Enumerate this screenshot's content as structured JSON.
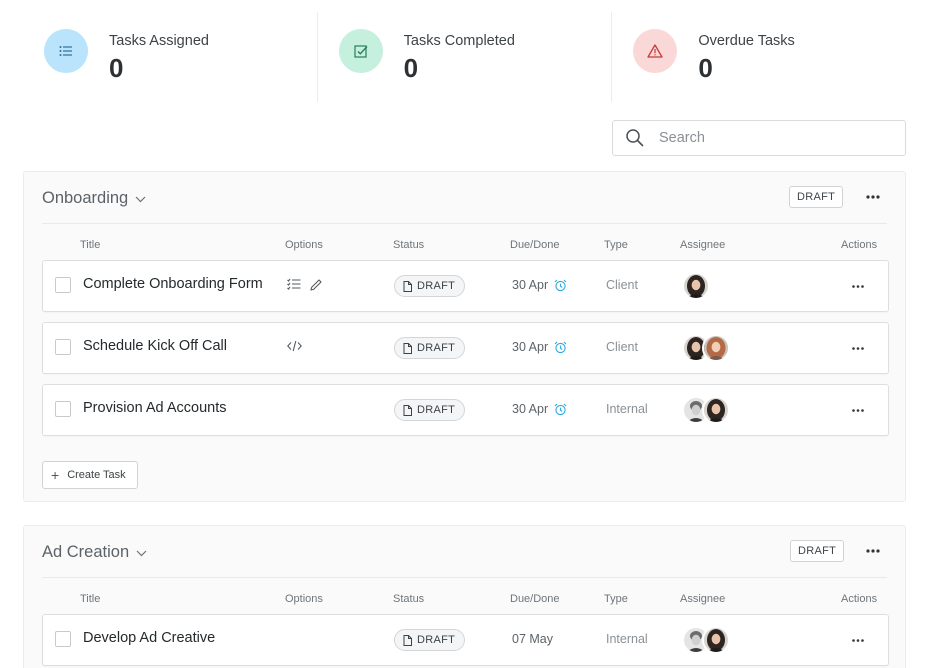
{
  "stats": [
    {
      "label": "Tasks Assigned",
      "value": "0",
      "icon": "list-icon",
      "color": "#b9e4fb"
    },
    {
      "label": "Tasks Completed",
      "value": "0",
      "icon": "check-square-icon",
      "color": "#c5f0de"
    },
    {
      "label": "Overdue Tasks",
      "value": "0",
      "icon": "warning-icon",
      "color": "#fbd8d8"
    }
  ],
  "search": {
    "placeholder": "Search"
  },
  "columns": {
    "title": "Title",
    "options": "Options",
    "status": "Status",
    "due": "Due/Done",
    "type": "Type",
    "assignee": "Assignee",
    "actions": "Actions"
  },
  "sections": [
    {
      "name": "Onboarding",
      "status": "DRAFT",
      "create_label": "Create Task",
      "tasks": [
        {
          "title": "Complete Onboarding Form",
          "status": "DRAFT",
          "due": "30 Apr",
          "type": "Client",
          "options": [
            "checklist-icon",
            "pencil-icon"
          ]
        },
        {
          "title": "Schedule Kick Off Call",
          "status": "DRAFT",
          "due": "30 Apr",
          "type": "Client",
          "options": [
            "code-icon"
          ]
        },
        {
          "title": "Provision Ad Accounts",
          "status": "DRAFT",
          "due": "30 Apr",
          "type": "Internal",
          "options": []
        }
      ]
    },
    {
      "name": "Ad Creation",
      "status": "DRAFT",
      "tasks": [
        {
          "title": "Develop Ad Creative",
          "status": "DRAFT",
          "due": "07 May",
          "type": "Internal",
          "options": []
        }
      ]
    }
  ],
  "colors": {
    "accent_alarm": "#2ea8e0"
  }
}
